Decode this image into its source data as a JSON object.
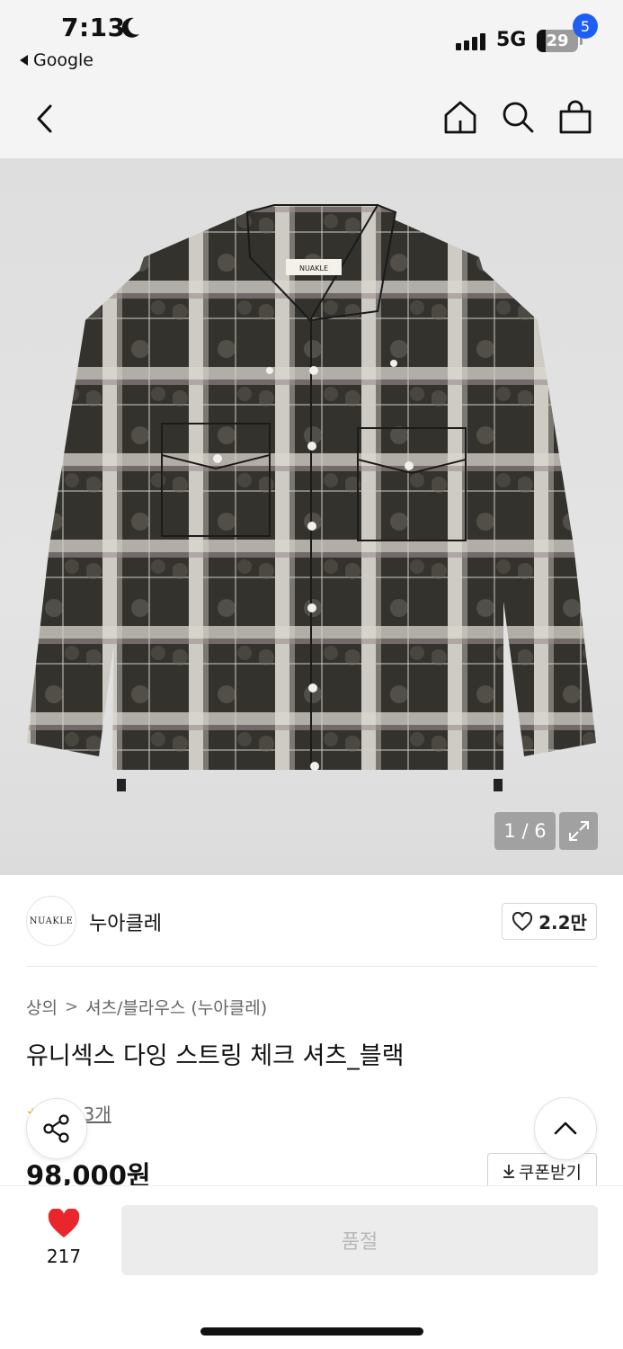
{
  "status_bar": {
    "time": "7:13",
    "back_app": "Google",
    "network": "5G",
    "battery": "29"
  },
  "nav": {
    "cart_count": "5",
    "icons": [
      "back-icon",
      "home-icon",
      "search-icon",
      "cart-icon"
    ]
  },
  "gallery": {
    "counter": "1 / 6",
    "label_on_shirt": "NUAKLE"
  },
  "brand": {
    "logo_text": "NUAKLE",
    "name": "누아클레",
    "likes": "2.2만"
  },
  "product": {
    "breadcrumb": [
      "상의",
      "셔츠/블라우스 (누아클레)"
    ],
    "title": "유니섹스 다잉 스트링 체크 셔츠_블랙",
    "review_text": "후기 3개",
    "price": "98,000원",
    "coupon_label": "쿠폰받기"
  },
  "bottom_bar": {
    "like_count": "217",
    "buy_label": "품절"
  },
  "colors": {
    "accent": "#1d5ff5",
    "heart": "#e8262b",
    "disabled_bg": "#ececec",
    "disabled_text": "#b8b8b8"
  }
}
